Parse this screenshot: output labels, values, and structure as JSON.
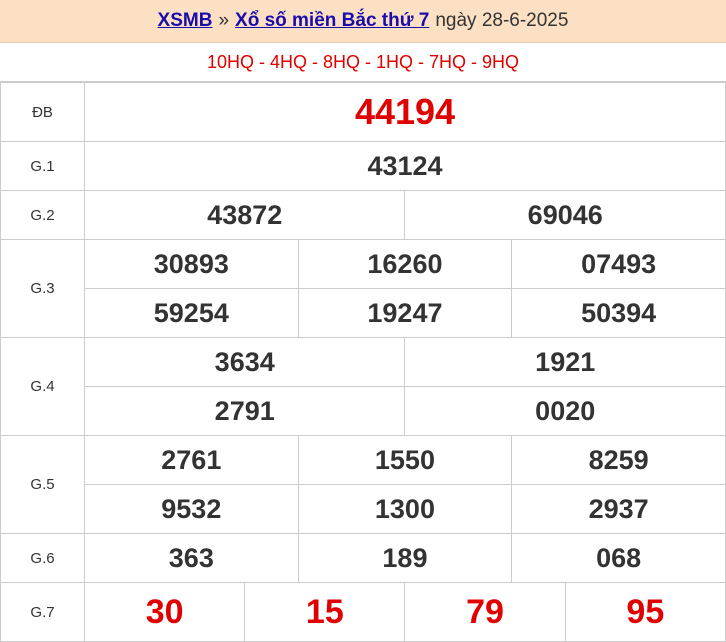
{
  "header": {
    "site_link": "XSMB",
    "separator": "»",
    "title_link": "Xổ số miền Bắc thứ 7",
    "date_text": "ngày 28-6-2025"
  },
  "codes": "10HQ - 4HQ - 8HQ - 1HQ - 7HQ - 9HQ",
  "prizes": {
    "db": {
      "label": "ĐB",
      "numbers": [
        "44194"
      ]
    },
    "g1": {
      "label": "G.1",
      "numbers": [
        "43124"
      ]
    },
    "g2": {
      "label": "G.2",
      "numbers": [
        "43872",
        "69046"
      ]
    },
    "g3": {
      "label": "G.3",
      "numbers": [
        "30893",
        "16260",
        "07493",
        "59254",
        "19247",
        "50394"
      ]
    },
    "g4": {
      "label": "G.4",
      "numbers": [
        "3634",
        "1921",
        "2791",
        "0020"
      ]
    },
    "g5": {
      "label": "G.5",
      "numbers": [
        "2761",
        "1550",
        "8259",
        "9532",
        "1300",
        "2937"
      ]
    },
    "g6": {
      "label": "G.6",
      "numbers": [
        "363",
        "189",
        "068"
      ]
    },
    "g7": {
      "label": "G.7",
      "numbers": [
        "30",
        "15",
        "79",
        "95"
      ]
    }
  },
  "colors": {
    "header_bg": "#fbe0c4",
    "link": "#1a0dab",
    "highlight_red": "#e00000",
    "border": "#cccccc"
  }
}
